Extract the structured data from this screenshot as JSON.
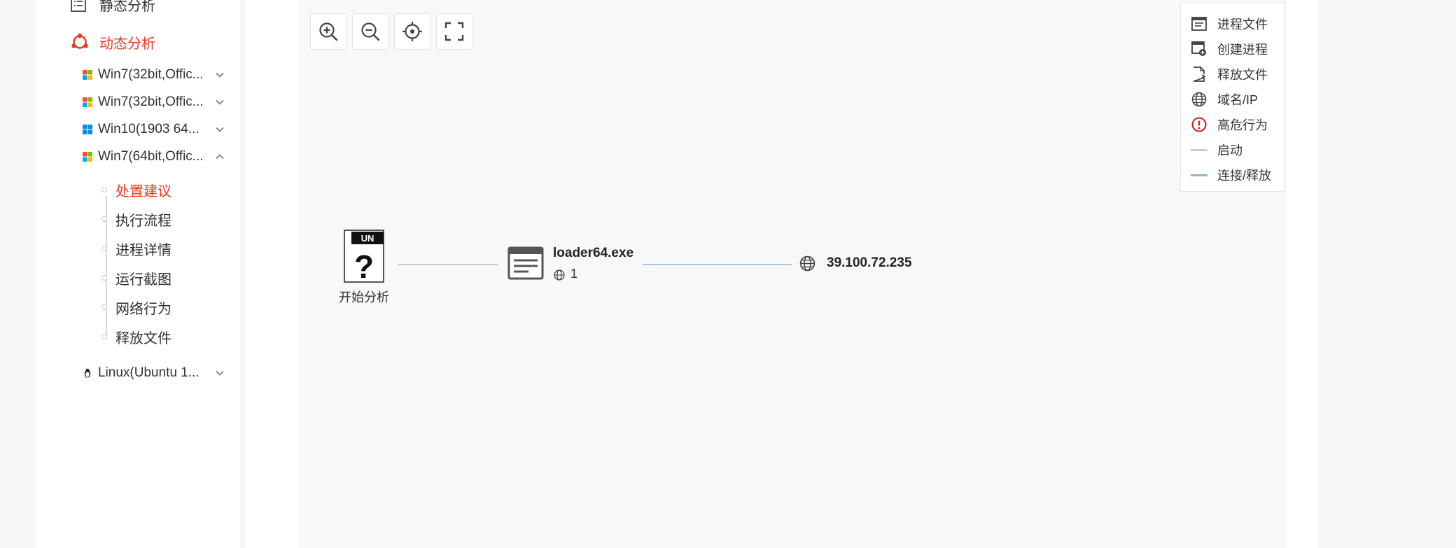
{
  "sidebar": {
    "static_analysis": "静态分析",
    "dynamic_analysis": "动态分析",
    "environments": [
      {
        "label": "Win7(32bit,Offic...",
        "os_icon": "windows7-icon",
        "expanded": false
      },
      {
        "label": "Win7(32bit,Offic...",
        "os_icon": "windows7-icon",
        "expanded": false
      },
      {
        "label": "Win10(1903 64...",
        "os_icon": "windows10-icon",
        "expanded": false
      },
      {
        "label": "Win7(64bit,Offic...",
        "os_icon": "windows7-icon",
        "expanded": true
      },
      {
        "label": "Linux(Ubuntu 1...",
        "os_icon": "linux-icon",
        "expanded": false
      }
    ],
    "sub_items": [
      {
        "label": "处置建议",
        "active": true
      },
      {
        "label": "执行流程",
        "active": false
      },
      {
        "label": "进程详情",
        "active": false
      },
      {
        "label": "运行截图",
        "active": false
      },
      {
        "label": "网络行为",
        "active": false
      },
      {
        "label": "释放文件",
        "active": false
      }
    ],
    "accent_color": "#e8391f"
  },
  "toolbar": [
    {
      "icon": "zoom-in-icon"
    },
    {
      "icon": "zoom-out-icon"
    },
    {
      "icon": "locate-icon"
    },
    {
      "icon": "fullscreen-icon"
    }
  ],
  "legend": [
    {
      "label": "进程文件",
      "icon": "process-file-icon"
    },
    {
      "label": "创建进程",
      "icon": "create-process-icon"
    },
    {
      "label": "释放文件",
      "icon": "release-file-icon"
    },
    {
      "label": "域名/IP",
      "icon": "globe-icon"
    },
    {
      "label": "高危行为",
      "icon": "alert-icon",
      "color": "#d4131a"
    },
    {
      "label": "启动",
      "icon": "start-line",
      "color": "#c8cdd3"
    },
    {
      "label": "连接/释放",
      "icon": "connect-line",
      "color": "#8fb3d9"
    }
  ],
  "graph": {
    "start_node": {
      "badge": "UN",
      "glyph": "?",
      "label": "开始分析"
    },
    "process_node": {
      "name": "loader64.exe",
      "count": "1"
    },
    "ip_node": {
      "label": "39.100.72.235"
    }
  }
}
